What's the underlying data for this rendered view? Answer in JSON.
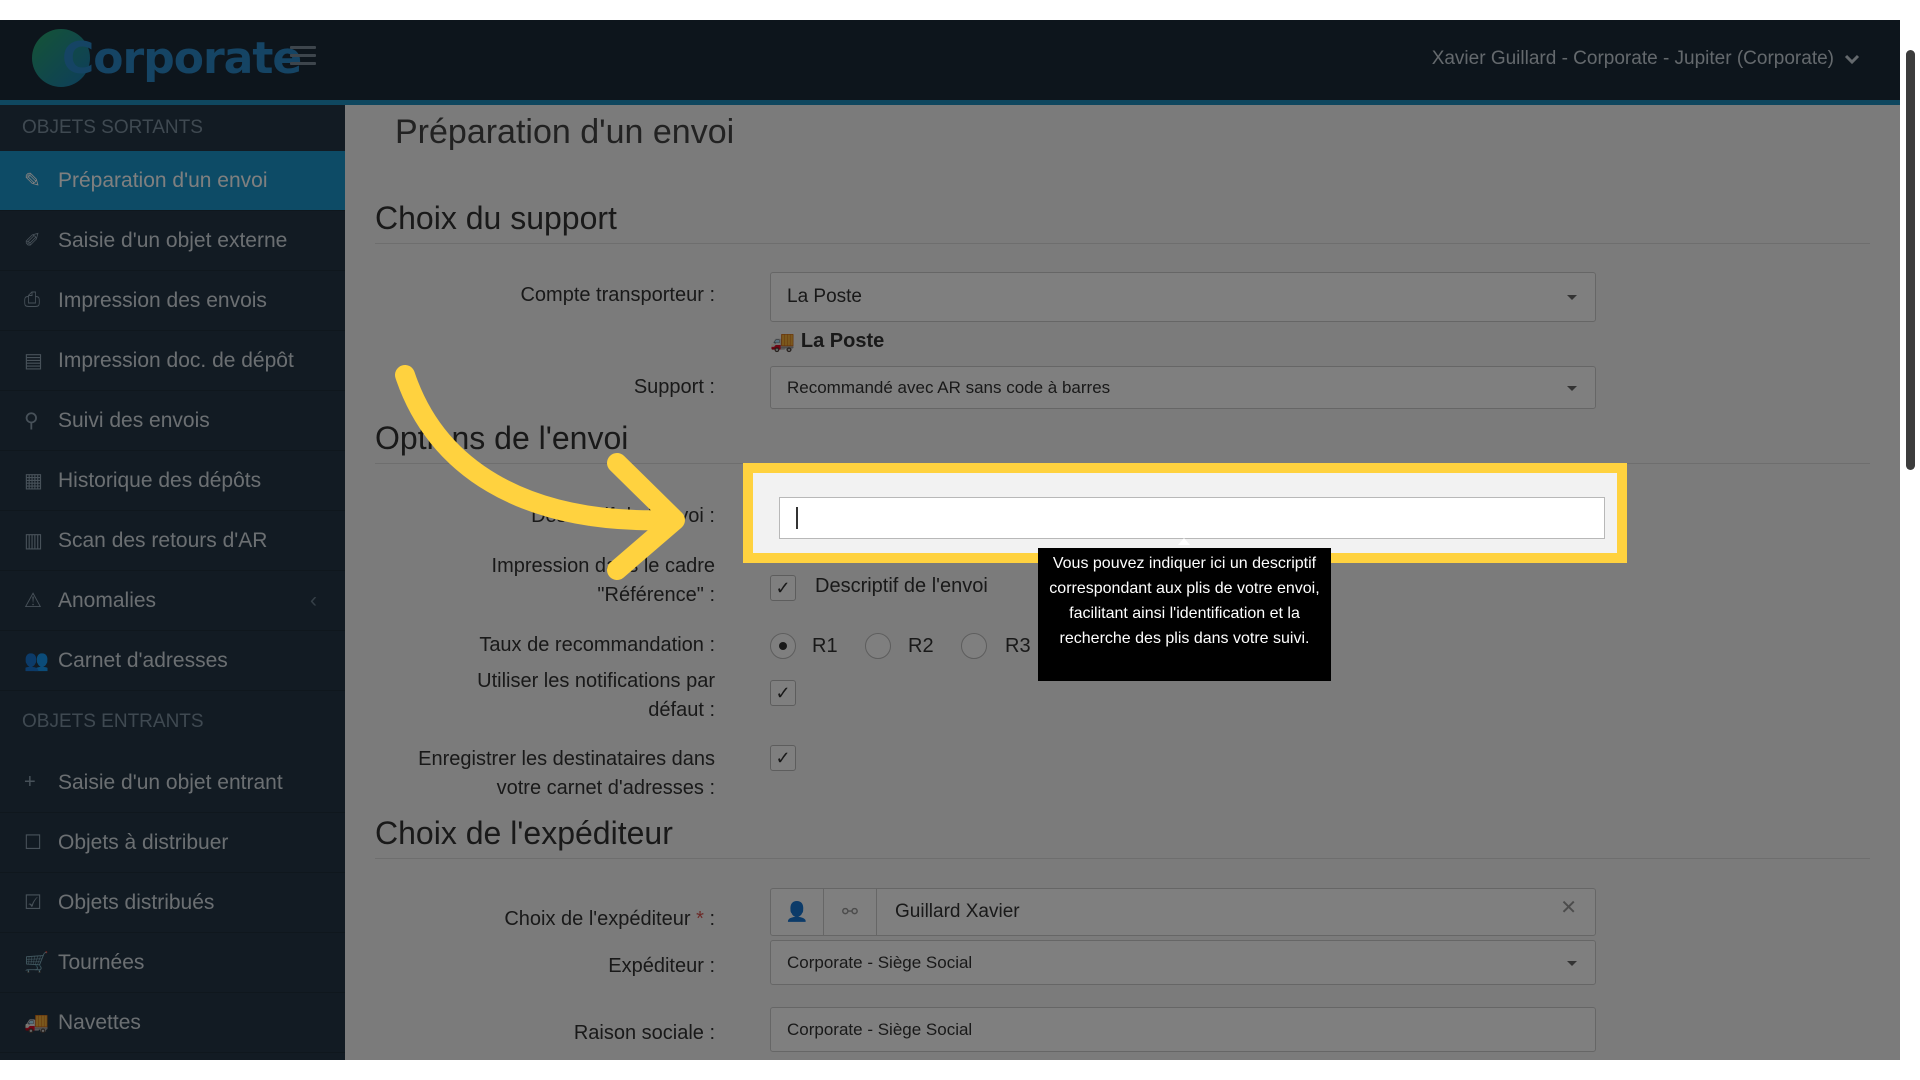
{
  "header": {
    "logo_text": "Corporate",
    "user_label": "Xavier Guillard - Corporate - Jupiter (Corporate)"
  },
  "sidebar": {
    "section_out": "OBJETS SORTANTS",
    "items_out": [
      {
        "label": "Préparation d'un envoi",
        "icon": "pencil-icon",
        "active": true
      },
      {
        "label": "Saisie d'un objet externe",
        "icon": "edit-external-icon"
      },
      {
        "label": "Impression des envois",
        "icon": "printer-icon"
      },
      {
        "label": "Impression doc. de dépôt",
        "icon": "document-icon"
      },
      {
        "label": "Suivi des envois",
        "icon": "search-icon"
      },
      {
        "label": "Historique des dépôts",
        "icon": "calendar-icon"
      },
      {
        "label": "Scan des retours d'AR",
        "icon": "barcode-icon"
      },
      {
        "label": "Anomalies",
        "icon": "warning-icon"
      },
      {
        "label": "Carnet d'adresses",
        "icon": "users-icon"
      }
    ],
    "section_in": "OBJETS ENTRANTS",
    "items_in": [
      {
        "label": "Saisie d'un objet entrant",
        "icon": "plus-icon"
      },
      {
        "label": "Objets à distribuer",
        "icon": "checkbox-empty-icon"
      },
      {
        "label": "Objets distribués",
        "icon": "checkbox-checked-icon"
      },
      {
        "label": "Tournées",
        "icon": "cart-icon"
      },
      {
        "label": "Navettes",
        "icon": "truck-icon"
      }
    ]
  },
  "main": {
    "page_title": "Préparation d'un envoi",
    "section_support": "Choix du support",
    "carrier_label": "Compte transporteur :",
    "carrier_value": "La Poste",
    "carrier_badge": "La Poste",
    "support_label": "Support :",
    "support_value": "Recommandé avec AR sans code à barres",
    "section_options": "Options de l'envoi",
    "description_label": "Descriptif de l'envoi :",
    "impression_label_1": "Impression dans le cadre",
    "impression_label_2": "\"Référence\" :",
    "impression_option": "Descriptif de l'envoi",
    "rate_label": "Taux de recommandation :",
    "rates": [
      "R1",
      "R2",
      "R3"
    ],
    "notif_label_1": "Utiliser les notifications par",
    "notif_label_2": "défaut :",
    "save_label_1": "Enregistrer les destinataires dans",
    "save_label_2": "votre carnet d'adresses :",
    "section_sender": "Choix de l'expéditeur",
    "sender_choice_label": "Choix de l'expéditeur",
    "required_mark": "*",
    "colon": ":",
    "sender_choice_value": "Guillard Xavier",
    "sender_label": "Expéditeur :",
    "sender_value": "Corporate - Siège Social",
    "company_label": "Raison sociale :",
    "company_value": "Corporate - Siège Social"
  },
  "tooltip": {
    "text": "Vous pouvez indiquer ici un descriptif correspondant aux plis de votre envoi, facilitant ainsi l'identification et la recherche des plis dans votre suivi."
  },
  "annotation": {
    "highlight_color": "#ffd23f"
  }
}
